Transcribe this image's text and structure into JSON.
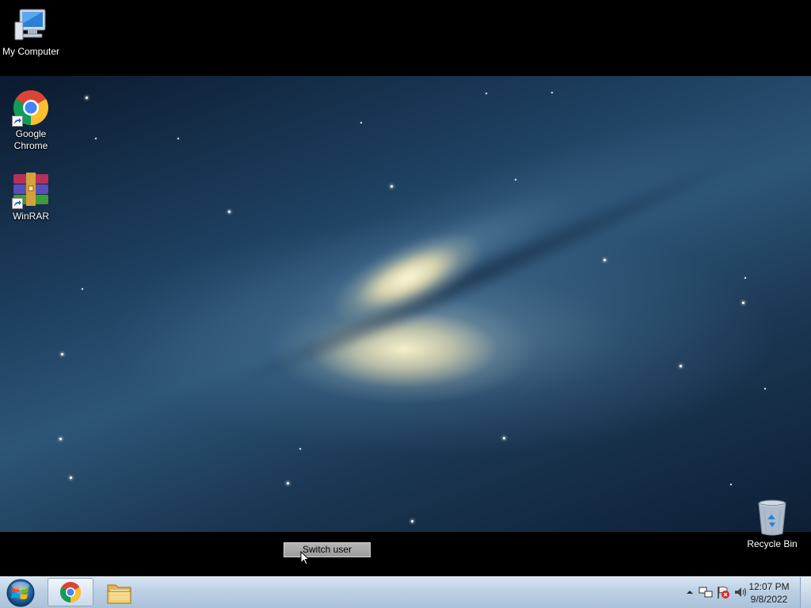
{
  "desktop_icons": [
    {
      "label": "My Computer",
      "icon": "computer-icon"
    },
    {
      "label": "Google\nChrome",
      "label_line1": "Google",
      "label_line2": "Chrome",
      "icon": "chrome-icon"
    },
    {
      "label": "WinRAR",
      "icon": "winrar-icon"
    },
    {
      "label": "Recycle Bin",
      "icon": "recycle-bin-icon"
    }
  ],
  "switch_user": {
    "label": "Switch user"
  },
  "taskbar": {
    "start": {
      "icon": "windows-start-icon"
    },
    "pinned": [
      {
        "name": "Google Chrome",
        "icon": "chrome-icon",
        "active": true
      },
      {
        "name": "Windows Explorer",
        "icon": "folder-icon",
        "active": false
      }
    ]
  },
  "tray": {
    "icons": [
      "show-hidden-icons-arrow",
      "network-icon",
      "action-center-flag-icon",
      "volume-icon"
    ],
    "time": "12:07 PM",
    "date": "9/8/2022"
  },
  "colors": {
    "taskbar": "#bcd0e4",
    "desktop_background": "#000000",
    "wallpaper_primary": "#2d5577",
    "switch_user_button": "#a8a8a8"
  }
}
